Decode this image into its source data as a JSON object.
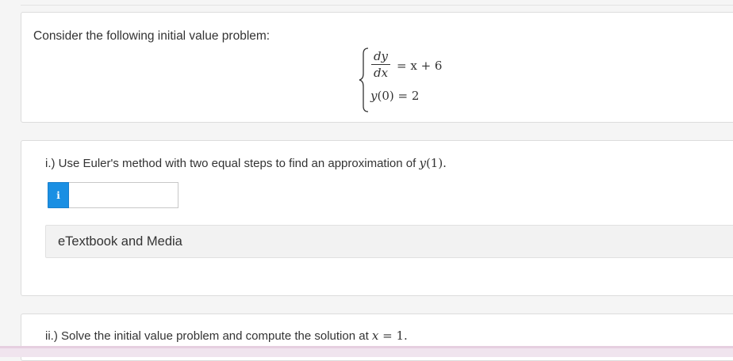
{
  "intro": {
    "prompt": "Consider the following initial value problem:",
    "ode": {
      "numerator": "dy",
      "denominator": "dx",
      "rhs": "= x + 6"
    },
    "initial_condition": {
      "lhs": "y",
      "arg": "(0)",
      "rhs": " = 2"
    }
  },
  "part1": {
    "text": "i.) Use Euler's method with two equal steps to find an approximation of ",
    "math_fn": "y",
    "math_arg": "(1).",
    "info_symbol": "i",
    "answer_value": "",
    "etextbook_label": "eTextbook and Media"
  },
  "part2": {
    "text": "ii.) Solve the initial value problem and compute the solution at ",
    "math_var": "x",
    "math_rest": " = 1."
  },
  "colors": {
    "info_button": "#1a8fe3",
    "card_border": "#dcdcdc",
    "etext_bg": "#f2f2f2"
  }
}
